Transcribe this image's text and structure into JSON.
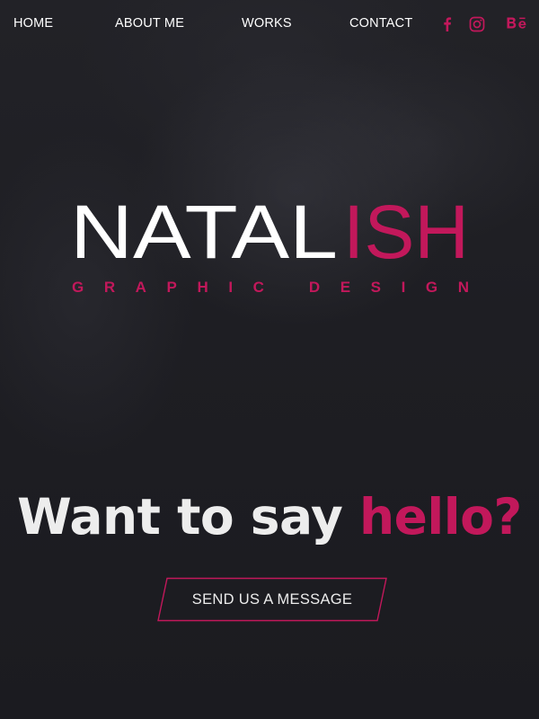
{
  "nav": {
    "items": [
      {
        "label": "HOME"
      },
      {
        "label": "ABOUT ME"
      },
      {
        "label": "WORKS"
      },
      {
        "label": "CONTACT"
      }
    ],
    "social": [
      {
        "icon": "facebook-icon"
      },
      {
        "icon": "instagram-icon"
      },
      {
        "icon": "behance-icon"
      }
    ]
  },
  "logo": {
    "name_white": "NATAL",
    "name_pink": "ISH",
    "tagline": "GRAPHIC DESIGN"
  },
  "hero": {
    "headline_white": "Want to say ",
    "headline_pink": "hello?",
    "cta_label": "SEND US A MESSAGE"
  },
  "colors": {
    "background": "#1d1d22",
    "accent": "#c2185b",
    "text": "#ffffff"
  }
}
